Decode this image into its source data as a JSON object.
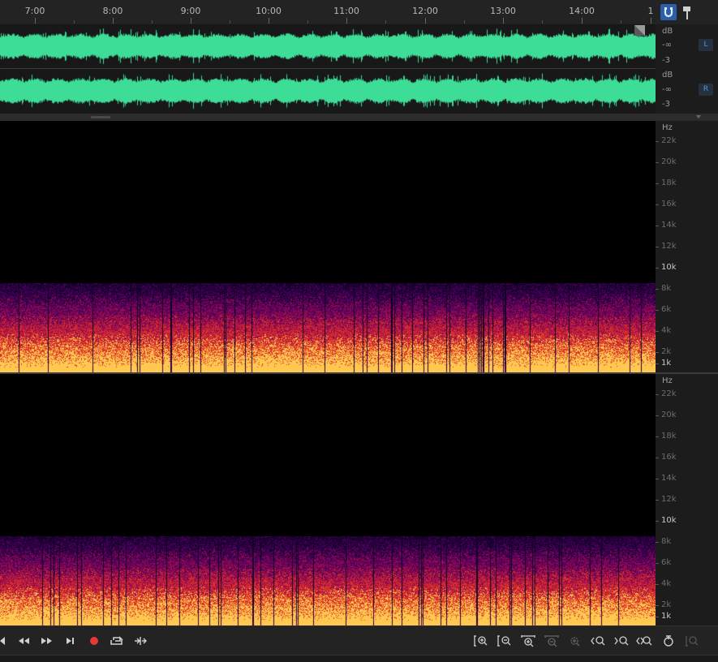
{
  "ruler": {
    "labels": [
      "7:00",
      "8:00",
      "9:00",
      "10:00",
      "11:00",
      "12:00",
      "13:00",
      "14:00",
      "1"
    ]
  },
  "waveform": {
    "channels": [
      {
        "name": "L",
        "db_label": "dB",
        "inf_label": "-∞",
        "min_label": "-3"
      },
      {
        "name": "R",
        "db_label": "dB",
        "inf_label": "-∞",
        "min_label": "-3"
      }
    ],
    "color": "#3ddc97"
  },
  "spectral": {
    "unit": "Hz",
    "labels": [
      "22k",
      "20k",
      "18k",
      "16k",
      "14k",
      "12k",
      "10k",
      "8k",
      "6k",
      "4k",
      "2k",
      "1k"
    ]
  },
  "colors": {
    "accent": "#2b5fa8",
    "record": "#e53935",
    "background": "#1e1e1e"
  },
  "toolbar": {
    "icons_left": [
      "skip-back-icon",
      "rewind-icon",
      "fast-forward-icon",
      "skip-forward-icon",
      "record-icon",
      "loop-icon",
      "skip-selection-icon"
    ],
    "icons_right": [
      "zoom-in-amplitude-icon",
      "zoom-out-amplitude-icon",
      "zoom-in-time-icon",
      "zoom-out-time-icon",
      "zoom-to-selection-icon",
      "zoom-in-left-icon",
      "zoom-in-right-icon",
      "zoom-out-full-icon",
      "zoom-reset-icon",
      "zoom-disabled-icon"
    ]
  }
}
